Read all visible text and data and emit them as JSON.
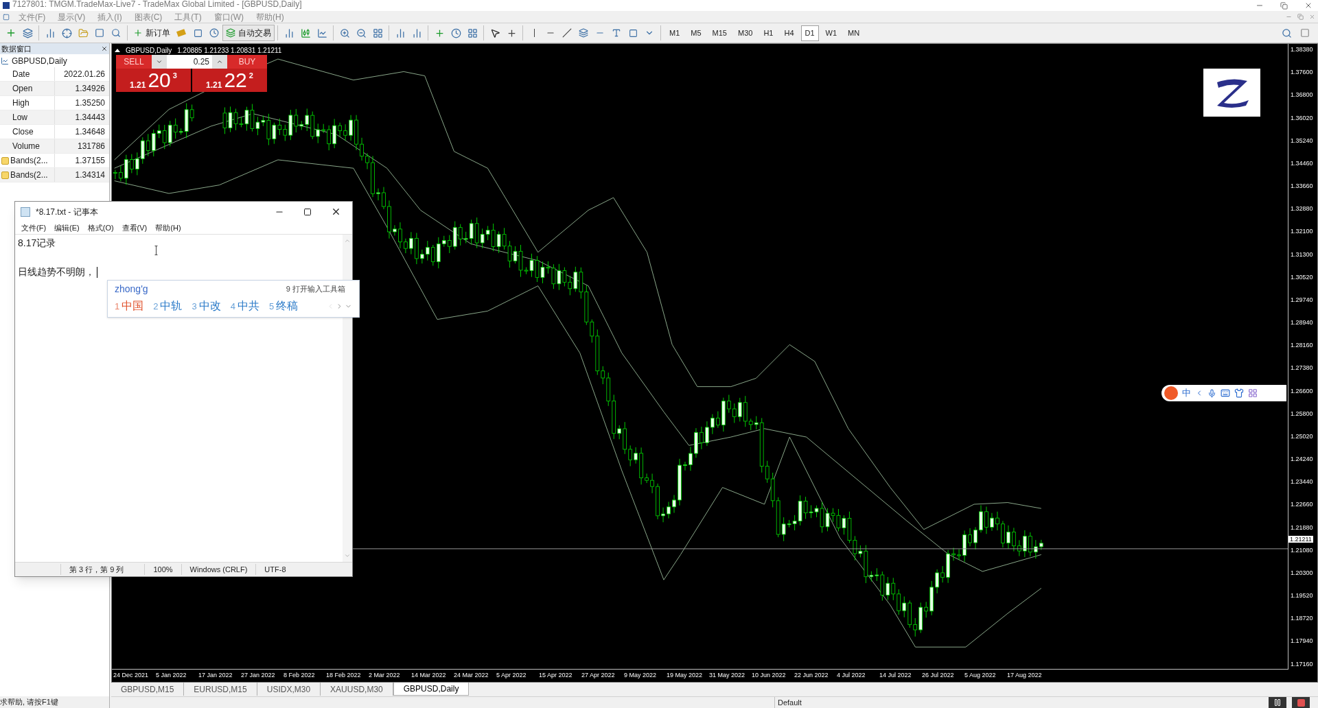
{
  "window": {
    "title": "7127801: TMGM.TradeMax-Live7 - TradeMax Global Limited - [GBPUSD,Daily]"
  },
  "menu": [
    "文件(F)",
    "显示(V)",
    "插入(I)",
    "图表(C)",
    "工具(T)",
    "窗口(W)",
    "帮助(H)"
  ],
  "toolbar": {
    "new_order": "新订单",
    "auto_trading": "自动交易",
    "timeframes": [
      {
        "label": "M1",
        "selected": false
      },
      {
        "label": "M5",
        "selected": false
      },
      {
        "label": "M15",
        "selected": false
      },
      {
        "label": "M30",
        "selected": false
      },
      {
        "label": "H1",
        "selected": false
      },
      {
        "label": "H4",
        "selected": false
      },
      {
        "label": "D1",
        "selected": true
      },
      {
        "label": "W1",
        "selected": false
      },
      {
        "label": "MN",
        "selected": false
      }
    ]
  },
  "data_window": {
    "title": "数据窗口",
    "symbol": "GBPUSD,Daily",
    "rows": [
      {
        "kind": "plain",
        "label": "Date",
        "value": "2022.01.26"
      },
      {
        "kind": "plain",
        "label": "Open",
        "value": "1.34926"
      },
      {
        "kind": "plain",
        "label": "High",
        "value": "1.35250"
      },
      {
        "kind": "plain",
        "label": "Low",
        "value": "1.34443"
      },
      {
        "kind": "plain",
        "label": "Close",
        "value": "1.34648"
      },
      {
        "kind": "plain",
        "label": "Volume",
        "value": "131786"
      },
      {
        "kind": "indicator",
        "label": "Bands(2...",
        "value": "1.37155"
      },
      {
        "kind": "indicator",
        "label": "Bands(2...",
        "value": "1.34314"
      }
    ]
  },
  "chart": {
    "symbol": "GBPUSD,Daily",
    "ohlc": "1.20885 1.21233 1.20831 1.21211",
    "trade_panel": {
      "sell": "SELL",
      "buy": "BUY",
      "volume": "0.25",
      "sell_price": {
        "prefix": "1.21",
        "big": "20",
        "small": "3"
      },
      "buy_price": {
        "prefix": "1.21",
        "big": "22",
        "small": "2"
      }
    },
    "price_labels": [
      "1.38380",
      "1.37600",
      "1.36800",
      "1.36020",
      "1.35240",
      "1.34460",
      "1.33660",
      "1.32880",
      "1.32100",
      "1.31300",
      "1.30520",
      "1.29740",
      "1.28940",
      "1.28160",
      "1.27380",
      "1.26600",
      "1.25800",
      "1.25020",
      "1.24240",
      "1.23440",
      "1.22660",
      "1.21880",
      "1.21080",
      "1.20300",
      "1.19520",
      "1.18720",
      "1.17940",
      "1.17160"
    ],
    "current_price": "1.21211",
    "date_labels": [
      "24 Dec 2021",
      "5 Jan 2022",
      "17 Jan 2022",
      "27 Jan 2022",
      "8 Feb 2022",
      "18 Feb 2022",
      "2 Mar 2022",
      "14 Mar 2022",
      "24 Mar 2022",
      "5 Apr 2022",
      "15 Apr 2022",
      "27 Apr 2022",
      "9 May 2022",
      "19 May 2022",
      "31 May 2022",
      "10 Jun 2022",
      "22 Jun 2022",
      "4 Jul 2022",
      "14 Jul 2022",
      "26 Jul 2022",
      "5 Aug 2022",
      "17 Aug 2022"
    ]
  },
  "chart_tabs": [
    {
      "label": "GBPUSD,M15",
      "selected": false
    },
    {
      "label": "EURUSD,M15",
      "selected": false
    },
    {
      "label": "USIDX,M30",
      "selected": false
    },
    {
      "label": "XAUUSD,M30",
      "selected": false
    },
    {
      "label": "GBPUSD,Daily",
      "selected": true
    }
  ],
  "status_bar": {
    "help": "求帮助, 请按F1键",
    "profile": "Default"
  },
  "notepad": {
    "title": "*8.17.txt - 记事本",
    "menu": [
      "文件(F)",
      "编辑(E)",
      "格式(O)",
      "查看(V)",
      "帮助(H)"
    ],
    "lines": [
      "8.17记录",
      "日线趋势不明朗，"
    ],
    "status": [
      "第 3 行，第 9 列",
      "100%",
      "Windows (CRLF)",
      "UTF-8"
    ]
  },
  "ime": {
    "input": "zhong'g",
    "toolbox": "9 打开输入工具箱",
    "candidates": [
      {
        "index": "1",
        "text": "中国",
        "selected": true
      },
      {
        "index": "2",
        "text": "中轨",
        "selected": false
      },
      {
        "index": "3",
        "text": "中改",
        "selected": false
      },
      {
        "index": "4",
        "text": "中共",
        "selected": false
      },
      {
        "index": "5",
        "text": "终稿",
        "selected": false
      }
    ]
  },
  "ime_bar": {
    "mode": "中"
  }
}
